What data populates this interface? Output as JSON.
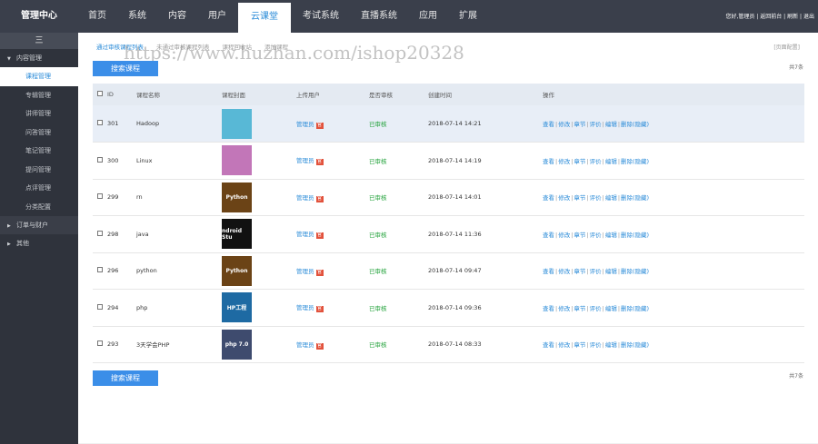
{
  "brand": "管理中心",
  "nav": [
    "首页",
    "系统",
    "内容",
    "用户",
    "云课堂",
    "考试系统",
    "直播系统",
    "应用",
    "扩展"
  ],
  "top_right": {
    "greeting": "您好,管理员",
    "links": [
      "返回前台",
      "刷新",
      "退出"
    ]
  },
  "sidebar": {
    "toggle": "三",
    "group_content": "内容管理",
    "items": [
      "课程管理",
      "专辑管理",
      "讲师管理",
      "问答管理",
      "笔记管理",
      "提问管理",
      "点评管理",
      "分类配置"
    ],
    "group_orders": "订单与财户",
    "group_other": "其他"
  },
  "tabs": [
    "通过审核课程列表",
    "未通过审核课程列表",
    "课程回收站",
    "添加课程"
  ],
  "page_config": "[页面配置]",
  "watermark": "https://www.huzhan.com/ishop20328",
  "search_btn": "搜索课程",
  "count": "共7条",
  "columns": [
    "ID",
    "课程名称",
    "课程封面",
    "上传用户",
    "是否审核",
    "创建时间",
    "操作"
  ],
  "rows": [
    {
      "id": "301",
      "name": "Hadoop",
      "thumb": {
        "text": "",
        "bg": "#58b8d6"
      },
      "user": "管理员",
      "badge": "官",
      "status": "已审核",
      "time": "2018-07-14 14:21"
    },
    {
      "id": "300",
      "name": "Linux",
      "thumb": {
        "text": "",
        "bg": "#c276b8"
      },
      "user": "管理员",
      "badge": "官",
      "status": "已审核",
      "time": "2018-07-14 14:19"
    },
    {
      "id": "299",
      "name": "rn",
      "thumb": {
        "text": "Python",
        "bg": "#6b4316"
      },
      "user": "管理员",
      "badge": "官",
      "status": "已审核",
      "time": "2018-07-14 14:01"
    },
    {
      "id": "298",
      "name": "java",
      "thumb": {
        "text": "ndroid Stu",
        "bg": "#111"
      },
      "user": "管理员",
      "badge": "官",
      "status": "已审核",
      "time": "2018-07-14 11:36"
    },
    {
      "id": "296",
      "name": "python",
      "thumb": {
        "text": "Python",
        "bg": "#6b4316"
      },
      "user": "管理员",
      "badge": "官",
      "status": "已审核",
      "time": "2018-07-14 09:47"
    },
    {
      "id": "294",
      "name": "php",
      "thumb": {
        "text": "HP工程",
        "bg": "#1e6aa3"
      },
      "user": "管理员",
      "badge": "官",
      "status": "已审核",
      "time": "2018-07-14 09:36"
    },
    {
      "id": "293",
      "name": "3天学会PHP",
      "thumb": {
        "text": "php 7.0",
        "bg": "#3e4b6e"
      },
      "user": "管理员",
      "badge": "官",
      "status": "已审核",
      "time": "2018-07-14 08:33"
    }
  ],
  "ops": [
    "查看",
    "修改",
    "章节",
    "评价",
    "编辑",
    "删除(隐藏)"
  ]
}
